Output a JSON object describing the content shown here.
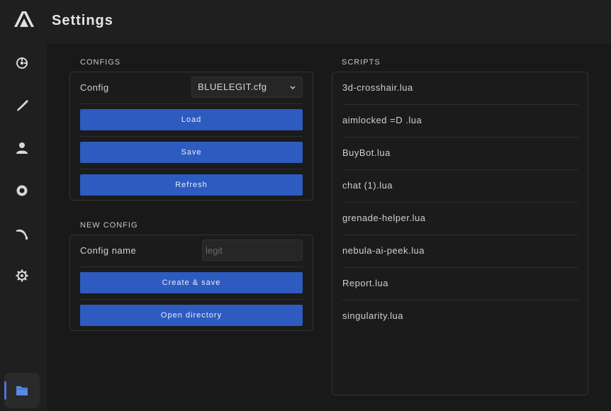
{
  "header": {
    "title": "Settings"
  },
  "sidebar": {
    "items": [
      {
        "icon": "crosshair-icon"
      },
      {
        "icon": "knife-icon"
      },
      {
        "icon": "user-icon"
      },
      {
        "icon": "eye-icon"
      },
      {
        "icon": "blade-icon"
      },
      {
        "icon": "gear-icon"
      },
      {
        "icon": "folder-icon",
        "active": true
      }
    ]
  },
  "configs": {
    "title": "CONFIGS",
    "config_label": "Config",
    "selected": "BLUELEGIT.cfg",
    "load_label": "Load",
    "save_label": "Save",
    "refresh_label": "Refresh"
  },
  "new_config": {
    "title": "NEW CONFIG",
    "name_label": "Config name",
    "name_placeholder": "legit",
    "create_label": "Create & save",
    "open_label": "Open directory"
  },
  "scripts": {
    "title": "SCRIPTS",
    "items": [
      "3d-crosshair.lua",
      "aimlocked =D .lua",
      "BuyBot.lua",
      "chat (1).lua",
      "grenade-helper.lua",
      "nebula-ai-peek.lua",
      "Report.lua",
      "singularity.lua"
    ]
  },
  "colors": {
    "accent": "#2d5bbf",
    "active_indicator": "#4a76d4",
    "background": "#1f1f1f"
  }
}
